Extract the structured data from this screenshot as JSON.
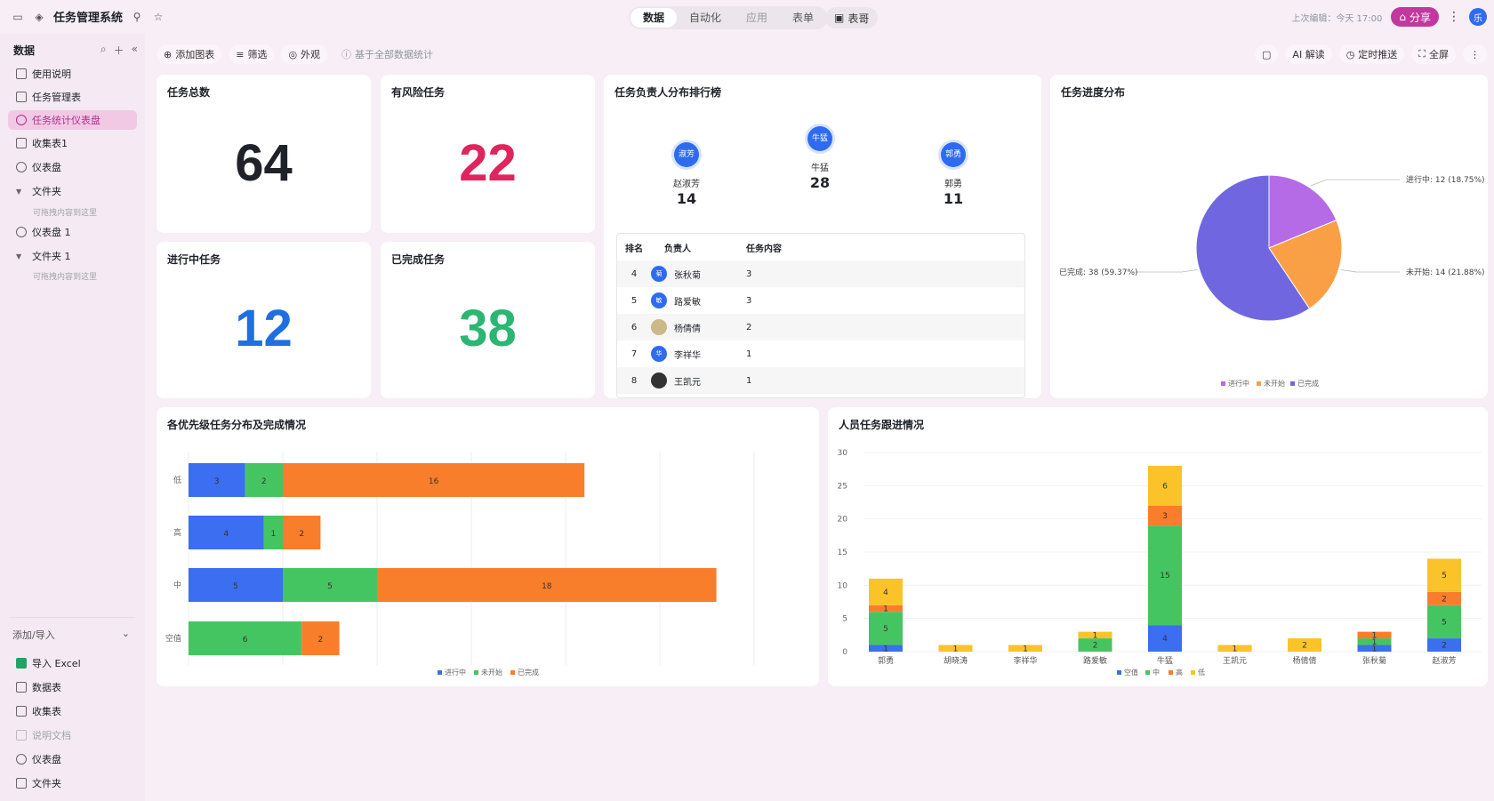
{
  "app": {
    "title": "任务管理系统",
    "last_edit": "上次编辑：今天 17:00",
    "share": "分享",
    "user_initial": "乐",
    "biaoge": "表哥"
  },
  "tabs": [
    "数据",
    "自动化",
    "应用",
    "表单"
  ],
  "sidebar": {
    "title": "数据",
    "items": [
      {
        "label": "使用说明"
      },
      {
        "label": "任务管理表"
      },
      {
        "label": "任务统计仪表盘"
      },
      {
        "label": "收集表1"
      },
      {
        "label": "仪表盘"
      },
      {
        "label": "文件夹"
      },
      {
        "label": "仪表盘 1"
      },
      {
        "label": "文件夹 1"
      }
    ],
    "folder_hint": "可拖拽内容到这里",
    "add_import": "添加/导入",
    "bottom": [
      "导入 Excel",
      "数据表",
      "收集表",
      "说明文档",
      "仪表盘",
      "文件夹"
    ]
  },
  "toolbar": {
    "add_chart": "添加图表",
    "filter": "筛选",
    "appearance": "外观",
    "stat_basis": "基于全部数据统计",
    "ai": "AI 解读",
    "push": "定时推送",
    "fullscreen": "全屏"
  },
  "cards": {
    "total": {
      "title": "任务总数",
      "value": "64",
      "color": "#1f2329"
    },
    "risk": {
      "title": "有风险任务",
      "value": "22",
      "color": "#e0245e"
    },
    "progress": {
      "title": "进行中任务",
      "value": "12",
      "color": "#1f6fde"
    },
    "done": {
      "title": "已完成任务",
      "value": "38",
      "color": "#2bb673"
    }
  },
  "ranking": {
    "title": "任务负责人分布排行榜",
    "podium": [
      {
        "avatar": "淑芳",
        "name": "赵淑芳",
        "count": "14"
      },
      {
        "avatar": "牛猛",
        "name": "牛猛",
        "count": "28"
      },
      {
        "avatar": "郭勇",
        "name": "郭勇",
        "count": "11"
      }
    ],
    "headers": [
      "排名",
      "负责人",
      "任务内容"
    ],
    "rows": [
      {
        "rank": "4",
        "avatar": "菊",
        "name": "张秋菊",
        "tasks": "3"
      },
      {
        "rank": "5",
        "avatar": "敏",
        "name": "路爱敏",
        "tasks": "3"
      },
      {
        "rank": "6",
        "avatar": "",
        "name": "杨倩倩",
        "tasks": "2"
      },
      {
        "rank": "7",
        "avatar": "华",
        "name": "李祥华",
        "tasks": "1"
      },
      {
        "rank": "8",
        "avatar": "",
        "name": "王凯元",
        "tasks": "1"
      }
    ]
  },
  "colors": {
    "blue": "#3b6ef0",
    "green": "#45c562",
    "orange": "#f97e2b",
    "yellow": "#fac32a",
    "purple_dark": "#7067e0",
    "purple_light": "#b56ae6",
    "pie_orange": "#f9a046"
  },
  "chart_data": [
    {
      "type": "pie",
      "title": "任务进度分布",
      "labels": [
        "进行中",
        "未开始",
        "已完成"
      ],
      "values": [
        12,
        14,
        38
      ],
      "value_labels": [
        "进行中: 12 (18.75%)",
        "未开始: 14 (21.88%)",
        "已完成: 38 (59.37%)"
      ],
      "legend": "bottom"
    },
    {
      "type": "bar",
      "orientation": "horizontal",
      "stacked": true,
      "title": "各优先级任务分布及完成情况",
      "categories": [
        "低",
        "高",
        "中",
        "空值"
      ],
      "series": [
        {
          "name": "进行中",
          "values": [
            3,
            4,
            5,
            0
          ]
        },
        {
          "name": "未开始",
          "values": [
            2,
            1,
            5,
            6
          ]
        },
        {
          "name": "已完成",
          "values": [
            16,
            2,
            18,
            2
          ]
        }
      ],
      "xlim": [
        0,
        30
      ],
      "legend": "bottom"
    },
    {
      "type": "bar",
      "stacked": true,
      "title": "人员任务跟进情况",
      "categories": [
        "郭勇",
        "胡晓涛",
        "李祥华",
        "路爱敏",
        "牛猛",
        "王凯元",
        "杨倩倩",
        "张秋菊",
        "赵淑芳"
      ],
      "series": [
        {
          "name": "空值",
          "values": [
            1,
            0,
            0,
            0,
            4,
            0,
            0,
            1,
            2
          ]
        },
        {
          "name": "中",
          "values": [
            5,
            0,
            0,
            2,
            15,
            0,
            0,
            1,
            5
          ]
        },
        {
          "name": "高",
          "values": [
            1,
            0,
            0,
            0,
            3,
            0,
            0,
            1,
            2
          ]
        },
        {
          "name": "低",
          "values": [
            4,
            1,
            1,
            1,
            6,
            1,
            2,
            0,
            5
          ]
        }
      ],
      "ylim": [
        0,
        30
      ],
      "yticks": [
        "0",
        "5",
        "10",
        "15",
        "20",
        "25",
        "30"
      ],
      "legend": "bottom"
    }
  ]
}
